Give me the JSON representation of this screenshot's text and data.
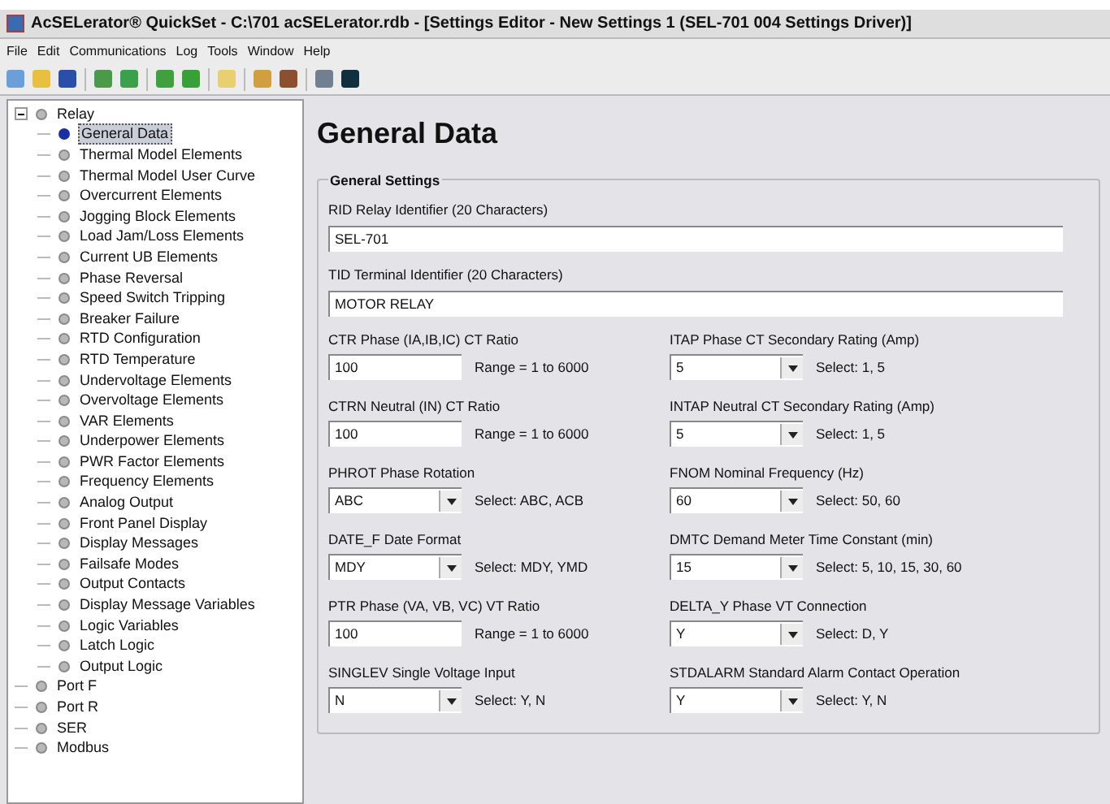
{
  "window": {
    "title": "AcSELerator® QuickSet - C:\\701 acSELerator.rdb - [Settings Editor - New Settings 1 (SEL-701 004 Settings Driver)]"
  },
  "menu": [
    "File",
    "Edit",
    "Communications",
    "Log",
    "Tools",
    "Window",
    "Help"
  ],
  "tree": [
    {
      "label": "Relay",
      "expanded": true,
      "selected": false,
      "children": [
        {
          "label": "General Data",
          "selected": true
        },
        {
          "label": "Thermal Model Elements",
          "selected": false
        },
        {
          "label": "Thermal Model User Curve",
          "selected": false
        },
        {
          "label": "Overcurrent Elements",
          "selected": false
        },
        {
          "label": "Jogging Block Elements",
          "selected": false
        },
        {
          "label": "Load Jam/Loss Elements",
          "selected": false
        },
        {
          "label": "Current UB Elements",
          "selected": false
        },
        {
          "label": "Phase Reversal",
          "selected": false
        },
        {
          "label": "Speed Switch Tripping",
          "selected": false
        },
        {
          "label": "Breaker Failure",
          "selected": false
        },
        {
          "label": "RTD Configuration",
          "selected": false
        },
        {
          "label": "RTD Temperature",
          "selected": false
        },
        {
          "label": "Undervoltage Elements",
          "selected": false
        },
        {
          "label": "Overvoltage Elements",
          "selected": false
        },
        {
          "label": "VAR Elements",
          "selected": false
        },
        {
          "label": "Underpower Elements",
          "selected": false
        },
        {
          "label": "PWR Factor Elements",
          "selected": false
        },
        {
          "label": "Frequency Elements",
          "selected": false
        },
        {
          "label": "Analog Output",
          "selected": false
        },
        {
          "label": "Front Panel Display",
          "selected": false
        },
        {
          "label": "Display Messages",
          "selected": false
        },
        {
          "label": "Failsafe Modes",
          "selected": false
        },
        {
          "label": "Output Contacts",
          "selected": false
        },
        {
          "label": "Display Message Variables",
          "selected": false
        },
        {
          "label": "Logic Variables",
          "selected": false
        },
        {
          "label": "Latch Logic",
          "selected": false
        },
        {
          "label": "Output Logic",
          "selected": false
        }
      ]
    },
    {
      "label": "Port F",
      "selected": false
    },
    {
      "label": "Port R",
      "selected": false
    },
    {
      "label": "SER",
      "selected": false
    },
    {
      "label": "Modbus",
      "selected": false
    }
  ],
  "page": {
    "title": "General Data",
    "group": "General Settings",
    "wide_fields": [
      {
        "label": "RID Relay Identifier (20 Characters)",
        "value": "SEL-701"
      },
      {
        "label": "TID Terminal Identifier (20 Characters)",
        "value": "MOTOR RELAY"
      }
    ],
    "fields": [
      {
        "kind": "text",
        "label": "CTR Phase (IA,IB,IC) CT Ratio",
        "value": "100",
        "hint": "Range = 1 to 6000"
      },
      {
        "kind": "select",
        "label": "ITAP Phase CT Secondary Rating (Amp)",
        "value": "5",
        "hint": "Select: 1, 5"
      },
      {
        "kind": "text",
        "label": "CTRN Neutral (IN) CT Ratio",
        "value": "100",
        "hint": "Range = 1 to 6000"
      },
      {
        "kind": "select",
        "label": "INTAP Neutral CT Secondary Rating (Amp)",
        "value": "5",
        "hint": "Select: 1, 5"
      },
      {
        "kind": "select",
        "label": "PHROT Phase Rotation",
        "value": "ABC",
        "hint": "Select: ABC, ACB"
      },
      {
        "kind": "select",
        "label": "FNOM Nominal Frequency (Hz)",
        "value": "60",
        "hint": "Select: 50, 60"
      },
      {
        "kind": "select",
        "label": "DATE_F Date Format",
        "value": "MDY",
        "hint": "Select: MDY, YMD"
      },
      {
        "kind": "select",
        "label": "DMTC Demand Meter Time Constant (min)",
        "value": "15",
        "hint": "Select: 5, 10, 15, 30, 60"
      },
      {
        "kind": "text",
        "label": "PTR Phase (VA, VB, VC) VT Ratio",
        "value": "100",
        "hint": "Range = 1 to 6000"
      },
      {
        "kind": "select",
        "label": "DELTA_Y Phase VT Connection",
        "value": "Y",
        "hint": "Select: D, Y"
      },
      {
        "kind": "select",
        "label": "SINGLEV Single Voltage Input",
        "value": "N",
        "hint": "Select: Y, N"
      },
      {
        "kind": "select",
        "label": "STDALARM Standard Alarm Contact Operation",
        "value": "Y",
        "hint": "Select: Y, N"
      }
    ]
  }
}
